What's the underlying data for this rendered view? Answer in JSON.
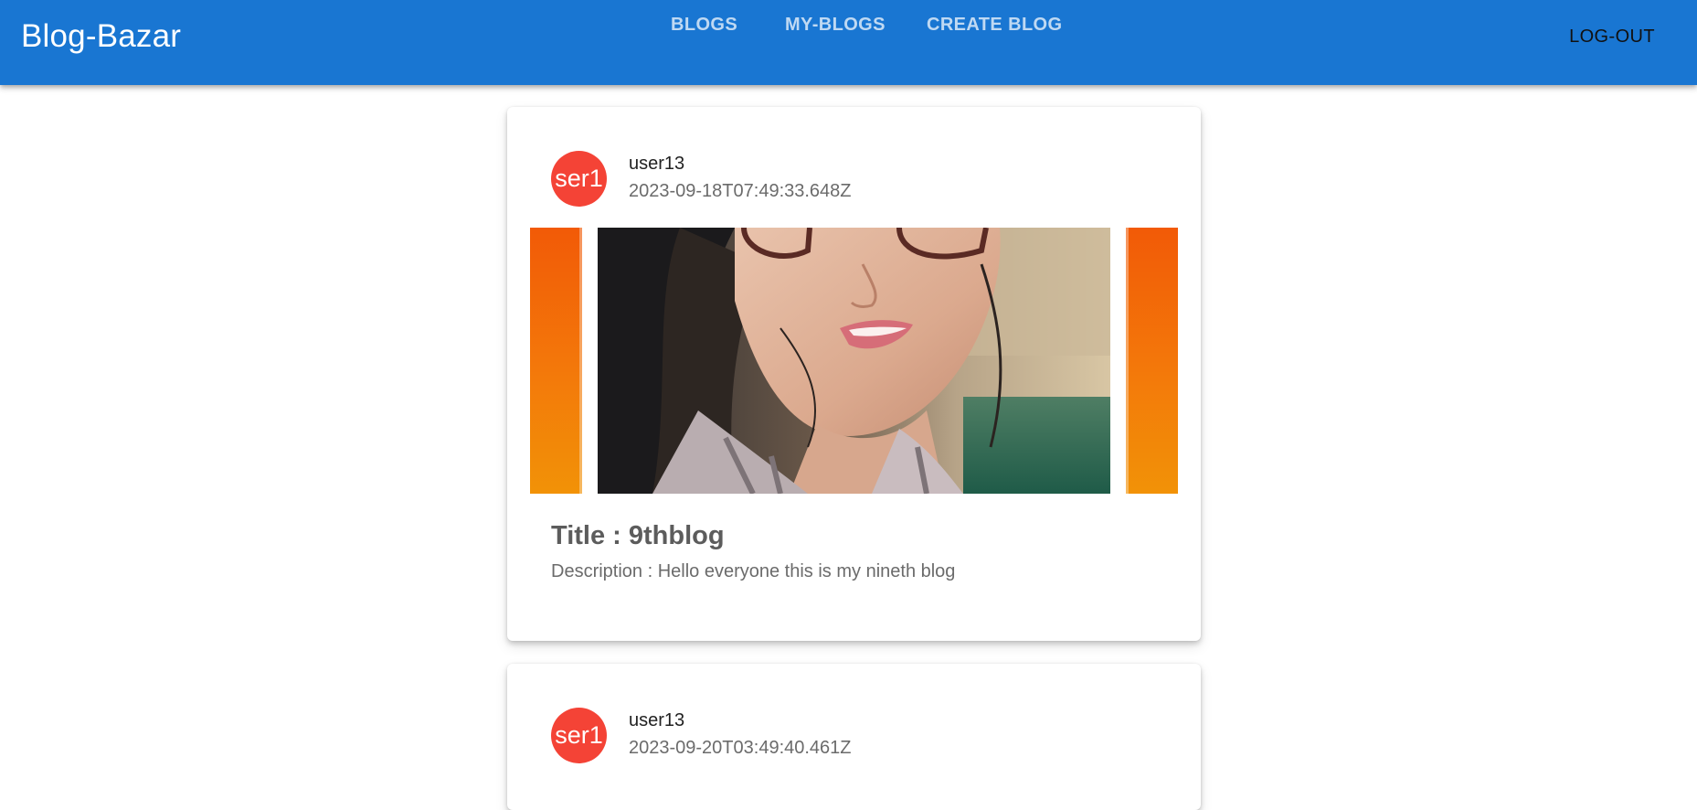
{
  "header": {
    "brand": "Blog-Bazar",
    "tabs": [
      {
        "label": "BLOGS"
      },
      {
        "label": "MY-BLOGS"
      },
      {
        "label": "CREATE BLOG"
      }
    ],
    "logout_label": "LOG-OUT"
  },
  "colors": {
    "appbar": "#1976d2",
    "avatar": "#f44336",
    "accent_orange": "#f3790a"
  },
  "posts": [
    {
      "avatar_text": "ser1",
      "username": "user13",
      "date": "2023-09-18T07:49:33.648Z",
      "title": "Title : 9thblog",
      "description": "Description : Hello everyone this is my nineth blog"
    },
    {
      "avatar_text": "ser1",
      "username": "user13",
      "date": "2023-09-20T03:49:40.461Z"
    }
  ]
}
